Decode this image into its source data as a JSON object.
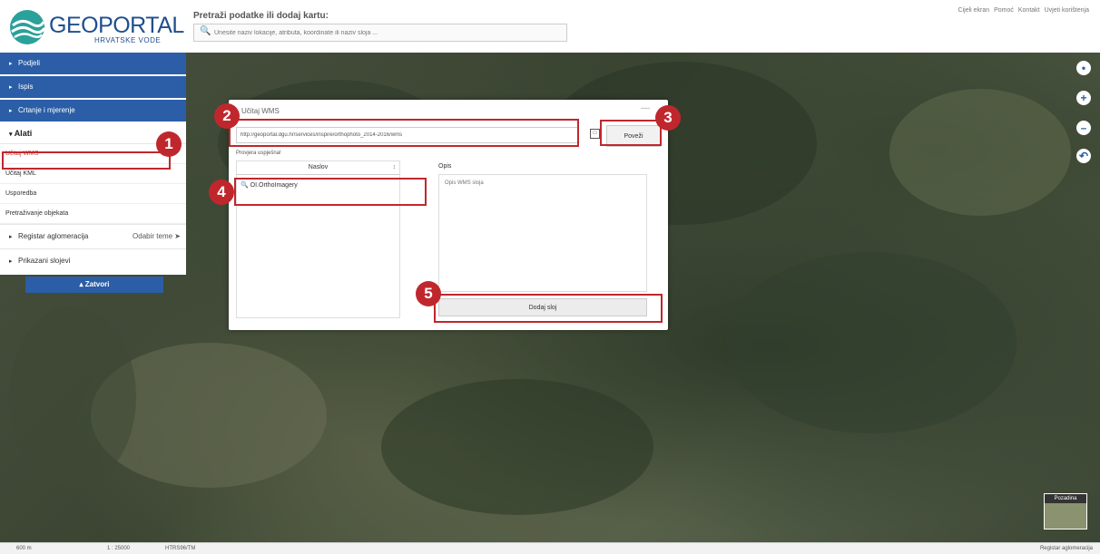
{
  "header": {
    "logo_title": "GEOPORTAL",
    "logo_subtitle": "HRVATSKE VODE",
    "search_label": "Pretraži podatke ili dodaj kartu:",
    "search_placeholder": "Unesite naziv lokacije, atributa, koordinate ili naziv sloja ...",
    "top_links": [
      "Cijeli ekran",
      "Pomoć",
      "Kontakt",
      "Uvjeti korištenja"
    ]
  },
  "sidebar": {
    "items": [
      {
        "label": "Podjeli"
      },
      {
        "label": "Ispis"
      },
      {
        "label": "Crtanje i mjerenje"
      }
    ],
    "alati_label": "Alati",
    "alati_items": [
      "Učitaj WMS",
      "Učitaj KML",
      "Usporedba",
      "Pretraživanje objekata"
    ],
    "registar_label": "Registar aglomeracija",
    "odabir_label": "Odabir teme",
    "prikazani_label": "Prikazani slojevi",
    "zatvori_label": "Zatvori"
  },
  "dialog": {
    "title": "Učitaj WMS",
    "url_value": "http://geoportal.dgu.hr/services/inspire/orthophoto_2014-2016/wms",
    "povezi_label": "Poveži",
    "status_text": "Provjera uspješna!",
    "naslov_header": "Naslov",
    "layer_name": "OI.OrthoImagery",
    "opis_label": "Opis",
    "opis_placeholder": "Opis WMS sloja",
    "dodaj_label": "Dodaj sloj"
  },
  "markers": [
    "1",
    "2",
    "3",
    "4",
    "5"
  ],
  "pozadina_label": "Pozadina",
  "footer": {
    "scale_bar": "600 m",
    "scale": "1 : 25000",
    "crs": "HTRS96/TM",
    "right_text": "Registar aglomeracija"
  },
  "colors": {
    "accent": "#2b5ea6",
    "highlight": "#c0272d"
  }
}
